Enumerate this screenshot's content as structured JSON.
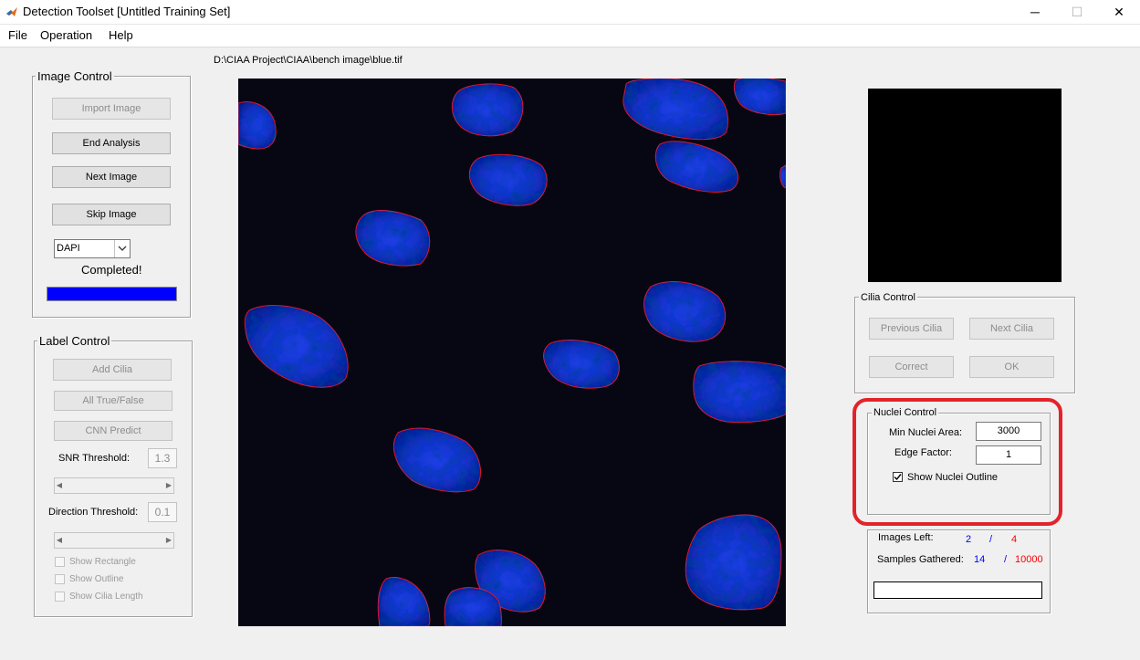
{
  "window": {
    "title": "Detection Toolset  [Untitled Training Set]",
    "minimize_glyph": "─",
    "maximize_glyph": "☐",
    "close_glyph": "✕",
    "icon": "matlab-logo-icon"
  },
  "menu": {
    "items": [
      "File",
      "Operation",
      "Help"
    ]
  },
  "image_path": "D:\\CIAA Project\\CIAA\\bench image\\blue.tif",
  "image_control": {
    "title": "Image Control",
    "import_label": "Import Image",
    "end_label": "End Analysis",
    "next_label": "Next Image",
    "skip_label": "Skip Image",
    "channel_value": "DAPI",
    "status_text": "Completed!",
    "progress_fraction": 1.0,
    "progress_color": "#0000ff"
  },
  "label_control": {
    "title": "Label Control",
    "add_label": "Add Cilia",
    "all_label": "All True/False",
    "cnn_label": "CNN Predict",
    "snr_label": "SNR Threshold:",
    "snr_value": "1.3",
    "dir_label": "Direction Threshold:",
    "dir_value": "0.1",
    "show_rect": "Show Rectangle",
    "show_outline": "Show Outline",
    "show_length": "Show Cilia Length"
  },
  "cilia_control": {
    "title": "Cilia Control",
    "prev_label": "Previous Cilia",
    "next_label": "Next Cilia",
    "correct_label": "Correct",
    "ok_label": "OK"
  },
  "nuclei_control": {
    "title": "Nuclei Control",
    "min_area_label": "Min Nuclei Area:",
    "min_area_value": "3000",
    "edge_label": "Edge Factor:",
    "edge_value": "1",
    "show_outline_label": "Show Nuclei Outline",
    "show_outline_checked": true,
    "highlight_color": "#e3232a"
  },
  "stats": {
    "images_left_label": "Images Left:",
    "images_left_done": "2",
    "images_left_sep": "/",
    "images_left_total": "4",
    "samples_label": "Samples Gathered:",
    "samples_done": "14",
    "samples_sep": "/",
    "samples_total": "10000",
    "done_color": "#0000ff",
    "total_color": "#ff0000"
  }
}
